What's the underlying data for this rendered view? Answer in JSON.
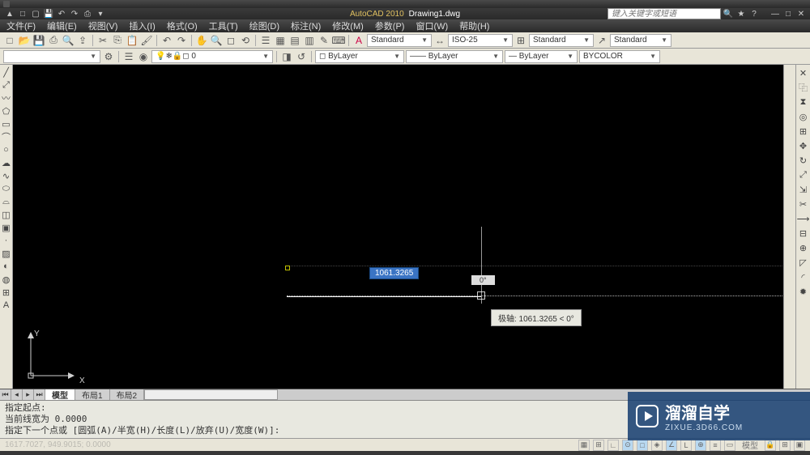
{
  "title": {
    "app": "AutoCAD 2010",
    "doc": "Drawing1.dwg",
    "search_placeholder": "键入关键字或短语"
  },
  "menu": {
    "file": "文件(F)",
    "edit": "编辑(E)",
    "view": "视图(V)",
    "insert": "插入(I)",
    "format": "格式(O)",
    "tools": "工具(T)",
    "draw": "绘图(D)",
    "dim": "标注(N)",
    "modify": "修改(M)",
    "param": "参数(P)",
    "window": "窗口(W)",
    "help": "帮助(H)"
  },
  "dropdowns": {
    "textstyle": "Standard",
    "dimstyle": "ISO-25",
    "tablestyle": "Standard",
    "mleaderstyle": "Standard",
    "layer": "0",
    "layerprop": "ByLayer",
    "linetype": "ByLayer",
    "lineweight": "ByLayer",
    "color": "BYCOLOR"
  },
  "tabs": {
    "model": "模型",
    "layout1": "布局1",
    "layout2": "布局2"
  },
  "dynamic": {
    "length": "1061.3265",
    "angle": "0°",
    "tooltip": "极轴: 1061.3265 < 0°"
  },
  "command": {
    "l1": "指定起点:",
    "l2": "当前线宽为  0.0000",
    "l3": "指定下一个点或 [圆弧(A)/半宽(H)/长度(L)/放弃(U)/宽度(W)]:"
  },
  "status": {
    "coords": "1617.7027, 949.9015; 0.0000",
    "model": "模型"
  },
  "watermark": {
    "name": "溜溜自学",
    "url": "ZIXUE.3D66.COM"
  },
  "ucs": {
    "x": "X",
    "y": "Y"
  }
}
